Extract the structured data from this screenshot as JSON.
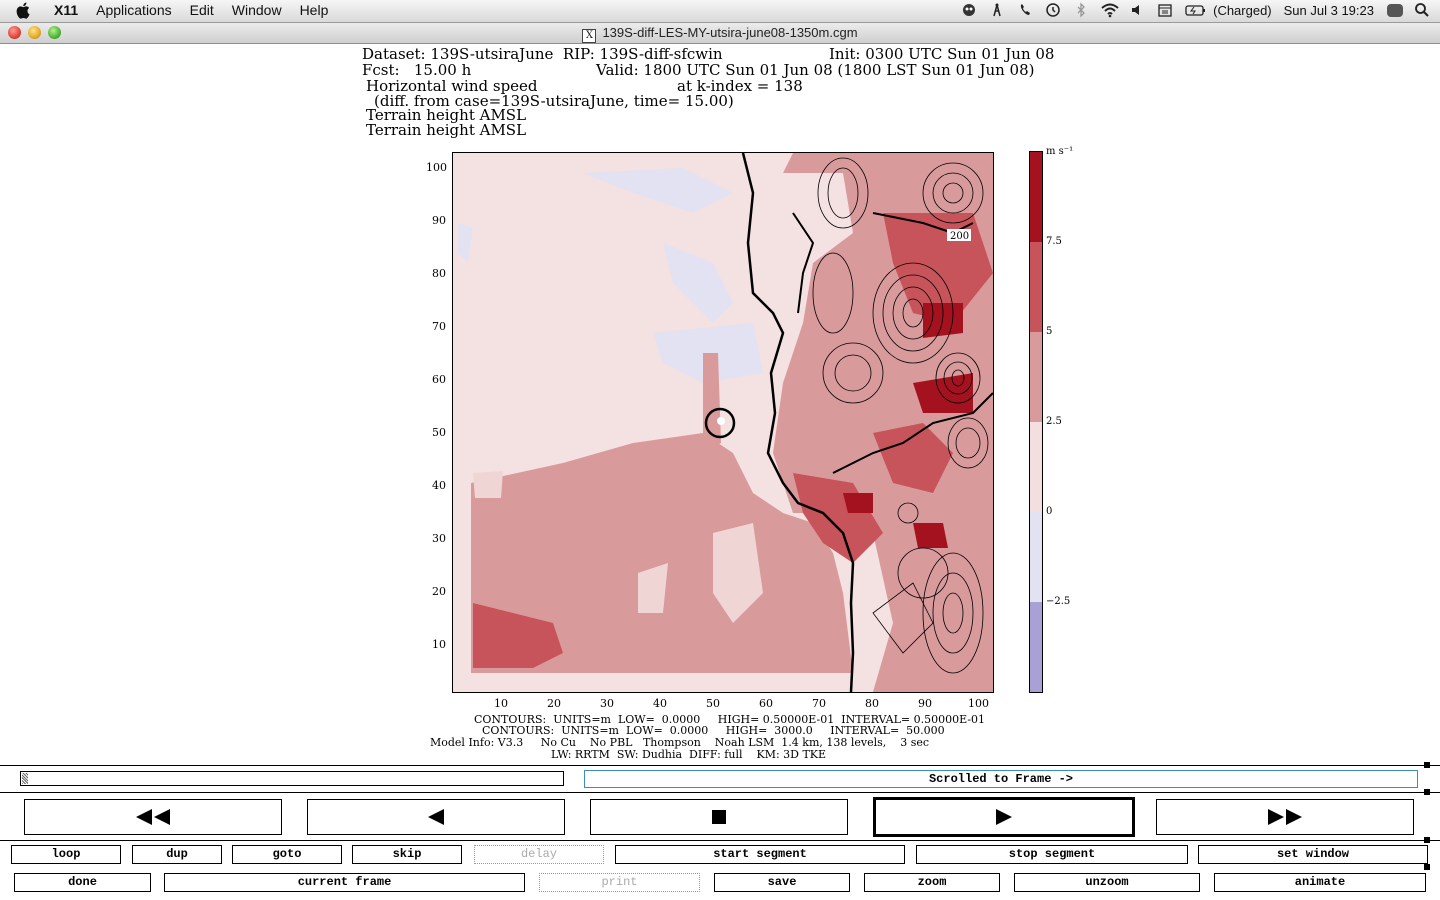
{
  "menubar": {
    "app": "X11",
    "menus": [
      "Applications",
      "Edit",
      "Window",
      "Help"
    ],
    "battery": "(Charged)",
    "clock": "Sun Jul 3  19:23"
  },
  "window": {
    "title": "139S-diff-LES-MY-utsira-june08-1350m.cgm"
  },
  "plot": {
    "header": {
      "line1a": "Dataset: 139S-utsiraJune  RIP: 139S-diff-sfcwin",
      "line1b": "Init: 0300 UTC Sun 01 Jun 08",
      "line2a": "Fcst:   15.00 h",
      "line2b": "Valid: 1800 UTC Sun 01 Jun 08 (1800 LST Sun 01 Jun 08)",
      "line3a": "Horizontal wind speed",
      "line3b": "at k-index = 138",
      "line4": "(diff. from case=139S-utsiraJune, time= 15.00)",
      "line5": "Terrain height AMSL",
      "line6": "Terrain height AMSL"
    },
    "y_ticks": [
      "100",
      "90",
      "80",
      "70",
      "60",
      "50",
      "40",
      "30",
      "20",
      "10"
    ],
    "x_ticks": [
      "10",
      "20",
      "30",
      "40",
      "50",
      "60",
      "70",
      "80",
      "90",
      "100"
    ],
    "contour_label": "200",
    "colorbar": {
      "unit": "m s⁻¹",
      "labels": [
        "7.5",
        "5",
        "2.5",
        "0",
        "−2.5"
      ],
      "colors": [
        "#a3121e",
        "#c7545a",
        "#d99a9c",
        "#f3dfdf",
        "#e2e2f2",
        "#a9a0d6"
      ]
    },
    "footer": {
      "line1": "CONTOURS:  UNITS=m  LOW=  0.0000     HIGH= 0.50000E-01  INTERVAL= 0.50000E-01",
      "line2": "CONTOURS:  UNITS=m  LOW=  0.0000     HIGH=  3000.0     INTERVAL=  50.000",
      "line3": "Model Info: V3.3     No Cu    No PBL   Thompson    Noah LSM  1.4 km, 138 levels,    3 sec",
      "line4": "LW: RRTM  SW: Dudhia  DIFF: full    KM: 3D TKE"
    }
  },
  "controls": {
    "frame_status": "Scrolled to Frame ->",
    "row1": [
      "loop",
      "dup",
      "goto",
      "skip",
      "delay",
      "start segment",
      "stop segment",
      "set window"
    ],
    "row2": [
      "done",
      "current frame",
      "print",
      "save",
      "zoom",
      "unzoom",
      "animate"
    ]
  }
}
